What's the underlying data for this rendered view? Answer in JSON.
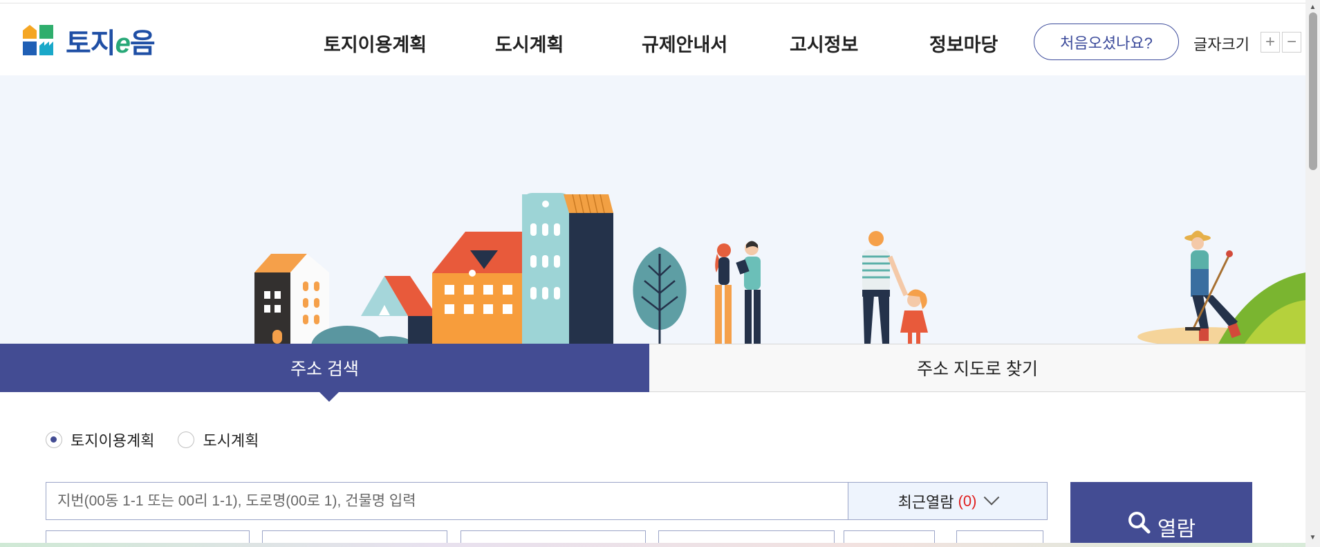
{
  "header": {
    "logo_text_1": "토지",
    "logo_text_e": "e",
    "logo_text_2": "음",
    "nav": [
      "토지이용계획",
      "도시계획",
      "규제안내서",
      "고시정보",
      "정보마당"
    ],
    "first_visit": "처음오셨나요?",
    "font_size_label": "글자크기",
    "font_plus": "+",
    "font_minus": "−"
  },
  "tabs": {
    "active": "주소 검색",
    "inactive": "주소 지도로 찾기"
  },
  "radios": [
    {
      "label": "토지이용계획",
      "checked": true
    },
    {
      "label": "도시계획",
      "checked": false
    }
  ],
  "search": {
    "placeholder": "지번(00동 1-1 또는 00리 1-1), 도로명(00로 1), 건물명 입력",
    "recent_label": "최근열람",
    "recent_count": "(0)",
    "view_label": "열람"
  },
  "colors": {
    "primary": "#434c93",
    "accent_red": "#e02020",
    "hero_bg": "#f2f6fc"
  },
  "icons": [
    "logo-mark-icon",
    "search-icon",
    "chevron-down-icon",
    "scroll-up-icon",
    "scroll-down-icon"
  ]
}
